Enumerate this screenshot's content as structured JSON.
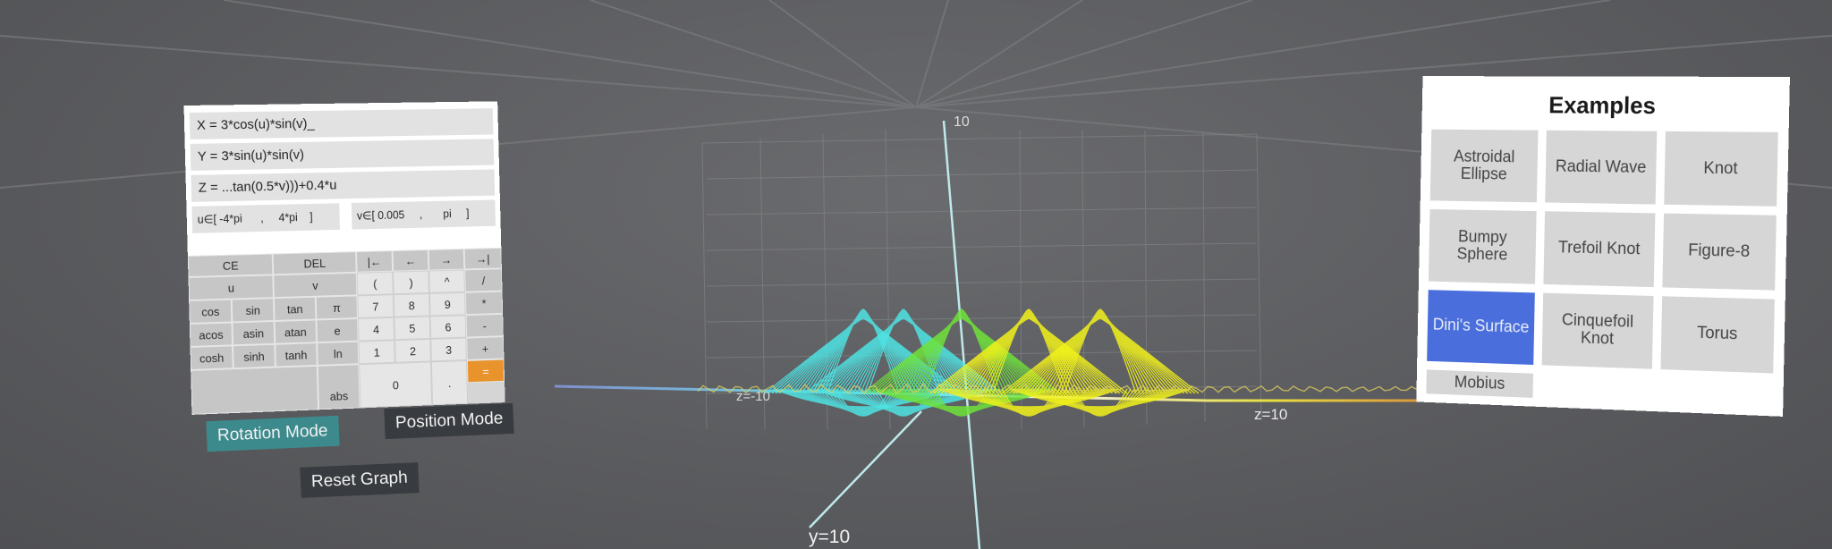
{
  "calculator": {
    "x_expr": "X = 3*cos(u)*sin(v)_",
    "y_expr": "Y = 3*sin(u)*sin(v)",
    "z_expr": "Z = ...tan(0.5*v)))+0.4*u",
    "u_range": "u∈[ -4*pi      ,     4*pi    ]",
    "v_range": "v∈[ 0.005     ,       pi     ]",
    "keys": {
      "ce": "CE",
      "del": "DEL",
      "home": "|←",
      "left": "←",
      "right": "→",
      "end": "→|",
      "u": "u",
      "v": "v",
      "lparen": "(",
      "rparen": ")",
      "pow": "^",
      "div": "/",
      "cos": "cos",
      "sin": "sin",
      "tan": "tan",
      "pi": "π",
      "acos": "acos",
      "asin": "asin",
      "atan": "atan",
      "e": "e",
      "cosh": "cosh",
      "sinh": "sinh",
      "tanh": "tanh",
      "ln": "ln",
      "abs": "abs",
      "n7": "7",
      "n8": "8",
      "n9": "9",
      "mul": "*",
      "n4": "4",
      "n5": "5",
      "n6": "6",
      "sub": "-",
      "n1": "1",
      "n2": "2",
      "n3": "3",
      "add": "+",
      "n0": "0",
      "dot": ".",
      "eq": "="
    }
  },
  "modes": {
    "rotation": "Rotation Mode",
    "position": "Position Mode",
    "reset": "Reset Graph"
  },
  "axes": {
    "top": "10",
    "z_left": "z=-10",
    "z_right": "z=10",
    "y_bottom": "y=10"
  },
  "examples": {
    "title": "Examples",
    "items": [
      "Astroidal Ellipse",
      "Radial Wave",
      "Knot",
      "Bumpy Sphere",
      "Trefoil Knot",
      "Figure-8",
      "Dini's Surface",
      "Cinquefoil Knot",
      "Torus",
      "Mobius"
    ],
    "active": "Dini's Surface"
  },
  "colors": {
    "accent_teal": "#3d8a8c",
    "selected_blue": "#4a6fdc",
    "equals_orange": "#e8932c",
    "surface_cyan": "#4fe3e3",
    "surface_yellow": "#f2f21c",
    "surface_green": "#6fe33a"
  }
}
